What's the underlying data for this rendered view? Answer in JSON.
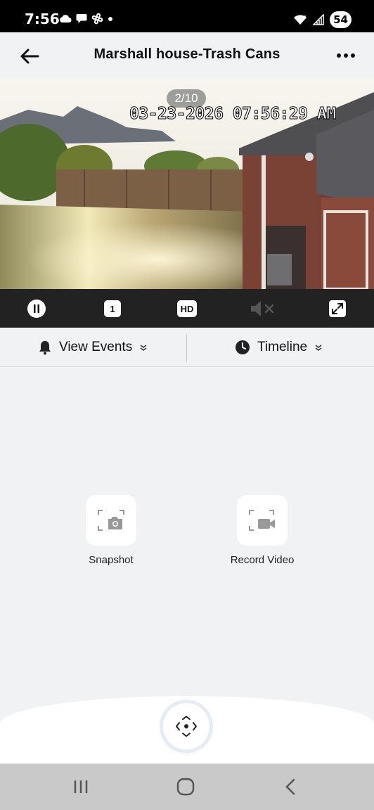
{
  "status_bar": {
    "time": "7:56",
    "battery": "54",
    "left_icons": [
      "cloud-icon",
      "chat-icon",
      "fan-icon",
      "dot-icon"
    ],
    "right_icons": [
      "wifi-icon",
      "signal-icon",
      "battery-icon"
    ]
  },
  "header": {
    "title": "Marshall house-Trash Cans",
    "back_icon": "arrow-left-icon",
    "more_icon": "more-horizontal-icon"
  },
  "video": {
    "page_counter": "2/10",
    "timestamp": "03-23-2026 07:56:29 AM"
  },
  "controls": {
    "pause_icon": "pause-icon",
    "channel_label": "1",
    "quality_label": "HD",
    "mute_icon": "speaker-muted-icon",
    "fullscreen_icon": "fullscreen-icon"
  },
  "tabs": [
    {
      "label": "View Events",
      "icon": "bell-icon"
    },
    {
      "label": "Timeline",
      "icon": "clock-icon"
    }
  ],
  "actions": [
    {
      "label": "Snapshot",
      "icon": "camera-icon"
    },
    {
      "label": "Record Video",
      "icon": "video-camera-icon"
    }
  ],
  "ptz": {
    "icon": "ptz-directions-icon"
  },
  "nav": {
    "recent_icon": "recent-apps-icon",
    "home_icon": "home-icon",
    "back_icon": "back-chevron-icon"
  },
  "colors": {
    "background": "#f1f2f4",
    "controls_bar": "#222222",
    "nav_bar": "#c9c9c9"
  }
}
